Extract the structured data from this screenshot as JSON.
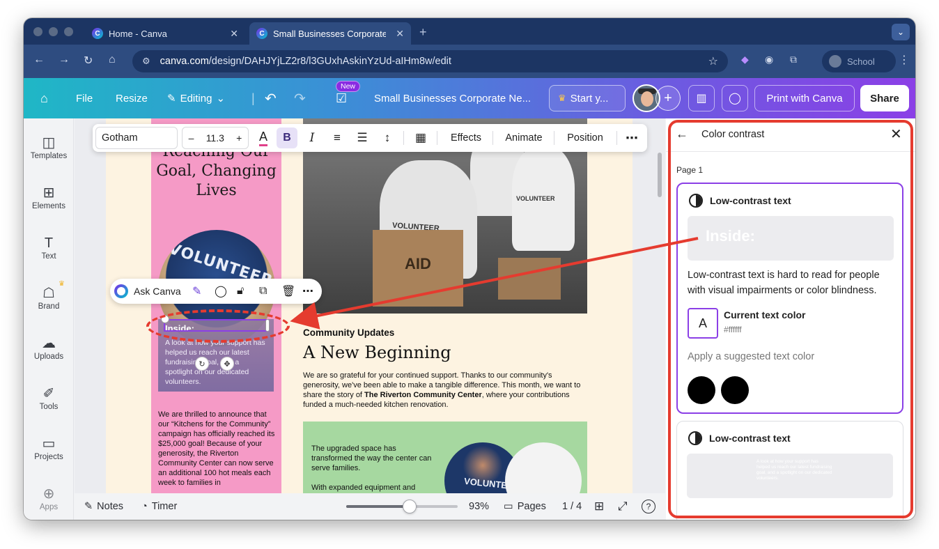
{
  "browser": {
    "tabs": [
      {
        "title": "Home - Canva",
        "active": false
      },
      {
        "title": "Small Businesses Corporate N",
        "active": true
      }
    ],
    "url_host": "canva.com",
    "url_path": "/design/DAHJYjLZ2r8/l3GUxhAskinYzUd-aIHm8w/edit",
    "profile_label": "School"
  },
  "header": {
    "file": "File",
    "resize": "Resize",
    "editing": "Editing",
    "new_badge": "New",
    "doc_title": "Small Businesses Corporate Ne...",
    "start_label": "Start y...",
    "print_label": "Print with Canva",
    "share_label": "Share"
  },
  "rail": {
    "items": [
      {
        "label": "Templates",
        "icon": "templates-icon"
      },
      {
        "label": "Elements",
        "icon": "elements-icon"
      },
      {
        "label": "Text",
        "icon": "text-icon"
      },
      {
        "label": "Brand",
        "icon": "brand-icon"
      },
      {
        "label": "Uploads",
        "icon": "uploads-icon"
      },
      {
        "label": "Tools",
        "icon": "tools-icon"
      },
      {
        "label": "Projects",
        "icon": "projects-icon"
      },
      {
        "label": "Apps",
        "icon": "apps-icon"
      }
    ]
  },
  "toolbar": {
    "font": "Gotham",
    "size": "11.3",
    "effects": "Effects",
    "animate": "Animate",
    "position": "Position"
  },
  "ask_canva": {
    "label": "Ask Canva"
  },
  "design": {
    "headline": "Reaching Our Goal, Changing Lives",
    "circle_shirt": "VOLUNTEER",
    "inside_title": "Inside:",
    "inside_body": "A look at how your support has helped us reach our latest fundraising goal, and a spotlight on our dedicated volunteers.",
    "pink_body": "We are thrilled to announce that our “Kitchens for the Community” campaign has officially reached its $25,000 goal! Because of your generosity, the Riverton Community Center can now serve an additional 100 hot meals each week to families in",
    "photo_vest_1": "VOLUNTEER",
    "photo_vest_2": "VOLUNTEER",
    "photo_box": "AID",
    "section_label": "Community Updates",
    "section_title": "A New Beginning",
    "body_pre": "We are so grateful for your continued support. Thanks to our community's generosity, we've been able to make a tangible difference. This month, we want to share the story of ",
    "body_bold": "The Riverton Community Center",
    "body_post": ", where your contributions funded a much-needed kitchen renovation.",
    "green_p1": "The upgraded space has transformed the way the center can serve families.",
    "green_p2": "With expanded equipment and",
    "green_shirt": "VOLUNTEER"
  },
  "bottombar": {
    "notes": "Notes",
    "timer": "Timer",
    "zoom": "93%",
    "zoom_level": 0.57,
    "pages": "Pages",
    "page_count": "1 / 4"
  },
  "panel": {
    "title": "Color contrast",
    "page_label": "Page 1",
    "card1": {
      "title": "Low-contrast text",
      "preview": "Inside:",
      "description": "Low-contrast text is hard to read for people with visual impairments or color blindness.",
      "current_label": "Current text color",
      "current_hex": "#ffffff",
      "swatch_letter": "A",
      "apply_label": "Apply a suggested text color",
      "suggestions": [
        "#000000",
        "#000000"
      ]
    },
    "card2": {
      "title": "Low-contrast text",
      "preview_small": "A look at how your support has helped us reach our latest fundraising goal, and a spotlight on our dedicated volunteers."
    }
  },
  "colors": {
    "accent": "#8b3fe6",
    "annotation": "#e53b2f",
    "pink": "#f59ac6",
    "green": "#a6d8a0"
  }
}
